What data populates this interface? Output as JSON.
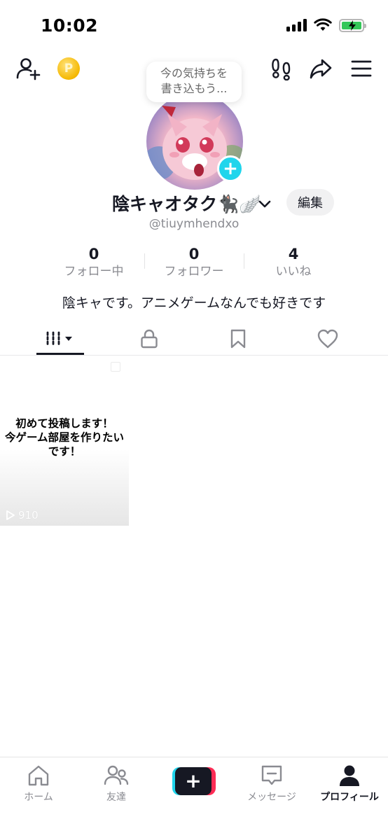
{
  "status_bar": {
    "time": "10:02"
  },
  "top_bar": {
    "coin_symbol": "P",
    "mood_prompt_line1": "今の気持ちを",
    "mood_prompt_line2": "書き込もう..."
  },
  "profile": {
    "display_name": "陰キャオタク🐈‍⬛🪽",
    "edit_label": "編集",
    "username": "@tiuymhendxo",
    "bio": "陰キャです。アニメゲームなんでも好きです"
  },
  "stats": [
    {
      "value": "0",
      "label": "フォロー中"
    },
    {
      "value": "0",
      "label": "フォロワー"
    },
    {
      "value": "4",
      "label": "いいね"
    }
  ],
  "videos": [
    {
      "caption_line1": "初めて投稿します！",
      "caption_line2": "今ゲーム部屋を作りたい",
      "caption_line3": "です！",
      "views": "910"
    }
  ],
  "bottom_nav": {
    "home": "ホーム",
    "friends": "友達",
    "create": "+",
    "inbox": "メッセージ",
    "profile": "プロフィール"
  },
  "colors": {
    "accent_cyan": "#20d5ec",
    "accent_red": "#fe2c55",
    "text_primary": "#161823",
    "text_secondary": "#8a8b91",
    "battery_green": "#34c759"
  }
}
